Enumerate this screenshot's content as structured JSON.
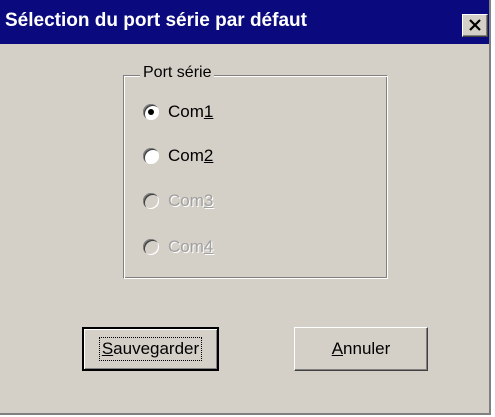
{
  "dialog": {
    "title": "Sélection du port série par défaut",
    "close_icon": "close-icon",
    "colors": {
      "titlebar": "#0a0a7e",
      "face": "#d4d0c8",
      "disabled_text": "#a0a0a0"
    }
  },
  "port_group": {
    "label": "Port série",
    "options": [
      {
        "pre": "Com",
        "accel": "1",
        "checked": true,
        "enabled": true
      },
      {
        "pre": "Com",
        "accel": "2",
        "checked": false,
        "enabled": true
      },
      {
        "pre": "Com",
        "accel": "3",
        "checked": false,
        "enabled": false
      },
      {
        "pre": "Com",
        "accel": "4",
        "checked": false,
        "enabled": false
      }
    ]
  },
  "buttons": {
    "save": {
      "accel": "S",
      "rest": "auvegarder"
    },
    "cancel": {
      "accel": "A",
      "rest": "nnuler"
    }
  }
}
